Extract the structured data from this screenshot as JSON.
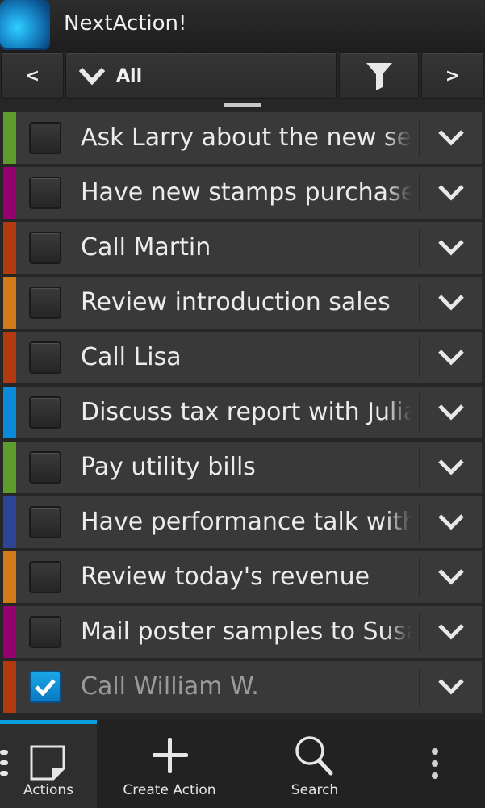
{
  "app": {
    "title": "NextAction!"
  },
  "toolbar": {
    "prev_label": "<",
    "next_label": ">",
    "filter_selected": "All"
  },
  "actions": [
    {
      "text": "Ask Larry about the new services",
      "color": "#5e9c2e",
      "checked": false
    },
    {
      "text": "Have new stamps purchased",
      "color": "#950070",
      "checked": false
    },
    {
      "text": "Call Martin",
      "color": "#b33a10",
      "checked": false
    },
    {
      "text": "Review introduction sales",
      "color": "#d07a18",
      "checked": false
    },
    {
      "text": "Call Lisa",
      "color": "#b33a10",
      "checked": false
    },
    {
      "text": "Discuss tax report with Julia",
      "color": "#0a8ad8",
      "checked": false
    },
    {
      "text": "Pay utility bills",
      "color": "#5e9c2e",
      "checked": false
    },
    {
      "text": "Have performance talk with",
      "color": "#2e4595",
      "checked": false
    },
    {
      "text": "Review today's revenue",
      "color": "#d07a18",
      "checked": false
    },
    {
      "text": "Mail poster samples to Susan",
      "color": "#950070",
      "checked": false
    },
    {
      "text": "Call William W.",
      "color": "#b33a10",
      "checked": true
    }
  ],
  "bottom_tabs": {
    "actions": "Actions",
    "create": "Create Action",
    "search": "Search"
  },
  "colors": {
    "accent": "#0a9fdc"
  }
}
